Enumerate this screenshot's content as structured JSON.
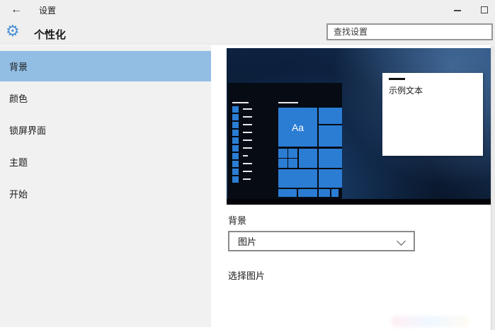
{
  "titlebar": {
    "title": "设置"
  },
  "icons": {
    "back": "←",
    "gear": "⚙"
  },
  "header": {
    "title": "个性化",
    "search_placeholder": "查找设置"
  },
  "sidebar": {
    "items": [
      {
        "label": "背景",
        "selected": true
      },
      {
        "label": "颜色",
        "selected": false
      },
      {
        "label": "锁屏界面",
        "selected": false
      },
      {
        "label": "主题",
        "selected": false
      },
      {
        "label": "开始",
        "selected": false
      }
    ]
  },
  "preview": {
    "start_tile_label": "Aa",
    "sample_text": "示例文本"
  },
  "content": {
    "background_section_label": "背景",
    "background_type_value": "图片",
    "choose_picture_label": "选择图片"
  },
  "colors": {
    "accent_blue": "#2b7dd4",
    "selected_item_bg": "#92bee4",
    "wallpaper_dark": "#0a1a33",
    "chrome_gray": "#efefef"
  }
}
